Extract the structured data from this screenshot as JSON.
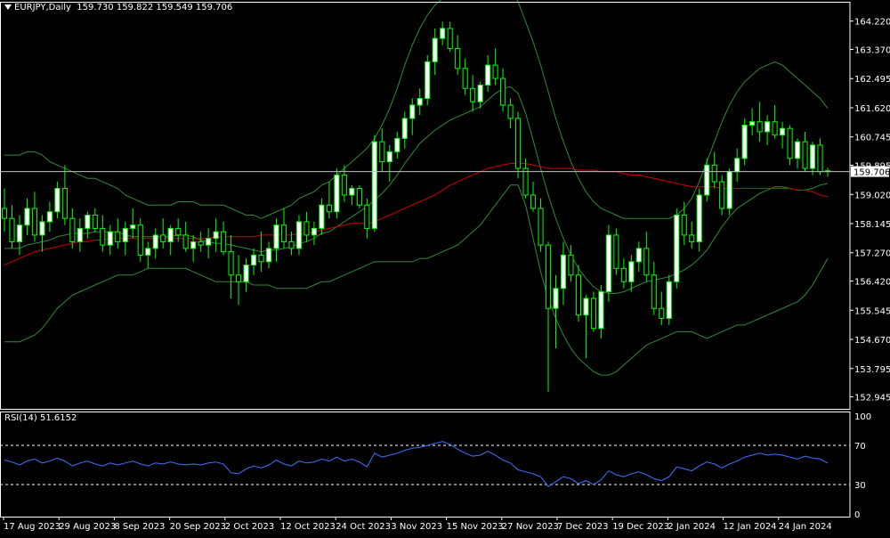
{
  "header": {
    "symbol_label": "EURJPY,Daily",
    "ohlc_label": "159.730 159.822 159.549 159.706"
  },
  "rsi": {
    "label": "RSI(14) 51.6152",
    "levels": [
      70,
      30
    ],
    "range": [
      0,
      100
    ],
    "tick_labels": [
      "100",
      "70",
      "30",
      "0"
    ]
  },
  "colors": {
    "background": "#000000",
    "frame": "#ffffff",
    "bull_body": "#ffffff",
    "bear_body": "#000000",
    "candle_outline": "#00ff00",
    "bollinger": "#2e8b3a",
    "ma": "#d40000",
    "rsi_line": "#3b74ff",
    "current_price_line": "#c0c0c0",
    "current_price_box_bg": "#ffffff",
    "current_price_box_text": "#000000"
  },
  "price_axis": {
    "ticks": [
      "164.220",
      "163.370",
      "162.495",
      "161.620",
      "160.745",
      "159.895",
      "159.020",
      "158.145",
      "157.270",
      "156.420",
      "155.545",
      "154.670",
      "153.795",
      "152.945"
    ],
    "current_price": "159.706"
  },
  "time_axis": {
    "labels": [
      "17 Aug 2023",
      "29 Aug 2023",
      "8 Sep 2023",
      "20 Sep 2023",
      "2 Oct 2023",
      "12 Oct 2023",
      "24 Oct 2023",
      "3 Nov 2023",
      "15 Nov 2023",
      "27 Nov 2023",
      "7 Dec 2023",
      "19 Dec 2023",
      "2 Jan 2024",
      "12 Jan 2024",
      "24 Jan 2024"
    ]
  },
  "chart_data": {
    "type": "candlestick",
    "symbol": "EURJPY",
    "timeframe": "Daily",
    "ylim": [
      152.8,
      164.8
    ],
    "candles": [
      [
        158.6,
        159.2,
        157.9,
        158.3
      ],
      [
        158.3,
        158.7,
        157.4,
        157.6
      ],
      [
        157.6,
        158.4,
        157.2,
        158.1
      ],
      [
        158.1,
        158.9,
        157.8,
        158.6
      ],
      [
        158.6,
        159.1,
        157.6,
        157.8
      ],
      [
        157.8,
        158.4,
        157.3,
        158.2
      ],
      [
        158.2,
        158.8,
        157.9,
        158.5
      ],
      [
        158.5,
        159.4,
        158.3,
        159.2
      ],
      [
        159.2,
        159.9,
        158.1,
        158.3
      ],
      [
        158.3,
        158.6,
        157.4,
        157.6
      ],
      [
        157.6,
        158.3,
        157.3,
        158.0
      ],
      [
        158.0,
        158.5,
        157.7,
        158.4
      ],
      [
        158.4,
        158.6,
        157.9,
        158.0
      ],
      [
        158.0,
        158.4,
        157.3,
        157.5
      ],
      [
        157.5,
        158.1,
        157.2,
        157.9
      ],
      [
        157.9,
        158.3,
        157.4,
        157.6
      ],
      [
        157.6,
        158.2,
        157.2,
        158.0
      ],
      [
        158.0,
        158.6,
        157.7,
        158.1
      ],
      [
        158.1,
        158.3,
        157.0,
        157.2
      ],
      [
        157.2,
        157.6,
        156.8,
        157.4
      ],
      [
        157.4,
        158.0,
        157.1,
        157.8
      ],
      [
        157.8,
        158.3,
        157.4,
        157.6
      ],
      [
        157.6,
        158.1,
        157.2,
        158.0
      ],
      [
        158.0,
        158.3,
        157.6,
        157.8
      ],
      [
        157.8,
        158.2,
        157.3,
        157.4
      ],
      [
        157.4,
        157.8,
        157.0,
        157.6
      ],
      [
        157.6,
        157.9,
        157.3,
        157.5
      ],
      [
        157.5,
        158.0,
        157.1,
        157.7
      ],
      [
        157.7,
        158.3,
        157.3,
        157.9
      ],
      [
        157.9,
        158.2,
        157.2,
        157.3
      ],
      [
        157.3,
        157.8,
        155.9,
        156.6
      ],
      [
        156.6,
        157.2,
        155.7,
        156.4
      ],
      [
        156.4,
        157.1,
        156.1,
        156.9
      ],
      [
        156.9,
        157.4,
        156.6,
        157.2
      ],
      [
        157.2,
        157.9,
        156.7,
        157.0
      ],
      [
        157.0,
        157.6,
        156.8,
        157.4
      ],
      [
        157.4,
        158.3,
        157.0,
        158.1
      ],
      [
        158.1,
        158.6,
        157.4,
        157.6
      ],
      [
        157.6,
        157.9,
        157.2,
        157.4
      ],
      [
        157.4,
        158.4,
        157.2,
        158.2
      ],
      [
        158.2,
        158.5,
        157.6,
        157.8
      ],
      [
        157.8,
        158.2,
        157.5,
        158.0
      ],
      [
        158.0,
        158.9,
        157.8,
        158.7
      ],
      [
        158.7,
        159.4,
        158.3,
        158.5
      ],
      [
        158.5,
        159.8,
        158.3,
        159.6
      ],
      [
        159.6,
        159.9,
        158.8,
        159.0
      ],
      [
        159.0,
        159.3,
        158.7,
        159.2
      ],
      [
        159.2,
        159.3,
        158.6,
        158.7
      ],
      [
        158.7,
        158.9,
        157.7,
        158.0
      ],
      [
        158.0,
        160.8,
        157.9,
        160.6
      ],
      [
        160.6,
        161.0,
        159.7,
        160.0
      ],
      [
        160.0,
        160.5,
        159.4,
        160.3
      ],
      [
        160.3,
        160.9,
        160.1,
        160.7
      ],
      [
        160.7,
        161.5,
        160.4,
        161.3
      ],
      [
        161.3,
        161.9,
        160.8,
        161.7
      ],
      [
        161.7,
        162.2,
        161.4,
        161.9
      ],
      [
        161.9,
        163.2,
        161.7,
        163.0
      ],
      [
        163.0,
        164.0,
        162.6,
        163.7
      ],
      [
        163.7,
        164.2,
        163.5,
        164.0
      ],
      [
        164.0,
        164.2,
        163.3,
        163.4
      ],
      [
        163.4,
        163.8,
        162.6,
        162.8
      ],
      [
        162.8,
        163.1,
        162.0,
        162.2
      ],
      [
        162.2,
        162.6,
        161.5,
        161.8
      ],
      [
        161.8,
        162.4,
        161.6,
        162.3
      ],
      [
        162.3,
        163.2,
        162.1,
        162.9
      ],
      [
        162.9,
        163.4,
        162.3,
        162.5
      ],
      [
        162.5,
        162.8,
        161.5,
        161.7
      ],
      [
        161.7,
        161.9,
        161.0,
        161.3
      ],
      [
        161.3,
        161.5,
        159.5,
        159.8
      ],
      [
        159.8,
        160.1,
        158.9,
        159.0
      ],
      [
        159.0,
        159.4,
        158.5,
        158.6
      ],
      [
        158.6,
        158.9,
        157.3,
        157.5
      ],
      [
        157.5,
        157.6,
        153.1,
        155.6
      ],
      [
        155.6,
        156.6,
        154.4,
        156.2
      ],
      [
        156.2,
        157.6,
        155.7,
        157.2
      ],
      [
        157.2,
        157.5,
        156.4,
        156.6
      ],
      [
        156.6,
        156.9,
        155.2,
        155.4
      ],
      [
        155.4,
        156.0,
        154.1,
        155.9
      ],
      [
        155.9,
        156.1,
        154.9,
        155.0
      ],
      [
        155.0,
        156.3,
        154.7,
        156.1
      ],
      [
        156.1,
        158.1,
        155.8,
        157.8
      ],
      [
        157.8,
        158.0,
        156.6,
        156.8
      ],
      [
        156.8,
        157.1,
        156.2,
        156.4
      ],
      [
        156.4,
        157.2,
        156.1,
        157.0
      ],
      [
        157.0,
        157.6,
        156.7,
        157.4
      ],
      [
        157.4,
        157.9,
        156.4,
        156.6
      ],
      [
        156.6,
        157.0,
        155.4,
        155.6
      ],
      [
        155.6,
        156.1,
        155.1,
        155.3
      ],
      [
        155.3,
        156.6,
        155.1,
        156.4
      ],
      [
        156.4,
        158.6,
        156.2,
        158.4
      ],
      [
        158.4,
        158.8,
        157.5,
        157.8
      ],
      [
        157.8,
        158.2,
        157.4,
        157.6
      ],
      [
        157.6,
        159.2,
        157.3,
        159.0
      ],
      [
        159.0,
        160.1,
        158.8,
        159.9
      ],
      [
        159.9,
        160.3,
        159.2,
        159.4
      ],
      [
        159.4,
        159.6,
        158.4,
        158.6
      ],
      [
        158.6,
        159.8,
        158.4,
        159.7
      ],
      [
        159.7,
        160.4,
        159.4,
        160.1
      ],
      [
        160.1,
        161.3,
        159.9,
        161.1
      ],
      [
        161.1,
        161.6,
        160.8,
        161.2
      ],
      [
        161.2,
        161.8,
        160.6,
        160.9
      ],
      [
        160.9,
        161.4,
        160.5,
        161.2
      ],
      [
        161.2,
        161.7,
        160.7,
        160.8
      ],
      [
        160.8,
        161.2,
        160.4,
        161.0
      ],
      [
        161.0,
        161.1,
        159.9,
        160.1
      ],
      [
        160.1,
        160.7,
        159.8,
        160.6
      ],
      [
        160.6,
        160.9,
        159.7,
        159.8
      ],
      [
        159.8,
        160.6,
        159.6,
        160.5
      ],
      [
        160.5,
        160.7,
        159.6,
        159.7
      ],
      [
        159.73,
        159.82,
        159.55,
        159.71
      ]
    ],
    "moving_average": [
      156.9,
      157.0,
      157.1,
      157.2,
      157.3,
      157.35,
      157.4,
      157.45,
      157.5,
      157.55,
      157.6,
      157.6,
      157.65,
      157.65,
      157.7,
      157.7,
      157.7,
      157.7,
      157.7,
      157.7,
      157.7,
      157.7,
      157.7,
      157.7,
      157.7,
      157.7,
      157.7,
      157.7,
      157.75,
      157.75,
      157.75,
      157.75,
      157.75,
      157.75,
      157.8,
      157.8,
      157.8,
      157.8,
      157.8,
      157.85,
      157.85,
      157.9,
      157.95,
      158.0,
      158.05,
      158.1,
      158.15,
      158.15,
      158.15,
      158.2,
      158.3,
      158.4,
      158.5,
      158.6,
      158.7,
      158.8,
      158.9,
      159.0,
      159.15,
      159.3,
      159.4,
      159.5,
      159.6,
      159.7,
      159.8,
      159.85,
      159.9,
      159.95,
      159.95,
      159.95,
      159.9,
      159.85,
      159.8,
      159.8,
      159.8,
      159.8,
      159.75,
      159.75,
      159.75,
      159.7,
      159.7,
      159.7,
      159.65,
      159.6,
      159.6,
      159.55,
      159.5,
      159.45,
      159.4,
      159.35,
      159.3,
      159.25,
      159.25,
      159.25,
      159.25,
      159.2,
      159.2,
      159.2,
      159.2,
      159.2,
      159.2,
      159.2,
      159.2,
      159.2,
      159.2,
      159.15,
      159.15,
      159.1,
      159.0,
      158.95
    ]
  },
  "bollinger_data": {
    "upper": [
      160.2,
      160.2,
      160.2,
      160.3,
      160.3,
      160.2,
      160.0,
      159.9,
      159.8,
      159.7,
      159.6,
      159.5,
      159.5,
      159.4,
      159.3,
      159.2,
      159.0,
      158.9,
      158.8,
      158.7,
      158.7,
      158.7,
      158.7,
      158.8,
      158.8,
      158.8,
      158.7,
      158.7,
      158.7,
      158.7,
      158.6,
      158.5,
      158.4,
      158.4,
      158.3,
      158.4,
      158.5,
      158.6,
      158.7,
      158.9,
      159.0,
      159.1,
      159.3,
      159.4,
      159.6,
      159.8,
      160.0,
      160.2,
      160.4,
      160.7,
      161.1,
      161.6,
      162.2,
      162.9,
      163.5,
      164.0,
      164.4,
      164.7,
      164.9,
      165.1,
      165.2,
      165.2,
      165.2,
      165.2,
      165.3,
      165.4,
      165.4,
      165.2,
      164.8,
      164.2,
      163.6,
      162.9,
      162.1,
      161.3,
      160.6,
      160.0,
      159.5,
      159.1,
      158.8,
      158.6,
      158.5,
      158.4,
      158.3,
      158.3,
      158.3,
      158.3,
      158.3,
      158.3,
      158.3,
      158.4,
      158.6,
      158.9,
      159.4,
      160.0,
      160.6,
      161.2,
      161.7,
      162.1,
      162.4,
      162.6,
      162.8,
      162.9,
      163.0,
      162.9,
      162.7,
      162.5,
      162.3,
      162.1,
      161.9,
      161.6
    ],
    "lower": [
      154.6,
      154.6,
      154.6,
      154.7,
      154.8,
      155.0,
      155.3,
      155.6,
      155.8,
      156.0,
      156.1,
      156.2,
      156.3,
      156.4,
      156.5,
      156.6,
      156.6,
      156.6,
      156.7,
      156.8,
      156.8,
      156.8,
      156.8,
      156.8,
      156.8,
      156.7,
      156.6,
      156.5,
      156.4,
      156.4,
      156.4,
      156.4,
      156.4,
      156.3,
      156.3,
      156.3,
      156.2,
      156.2,
      156.2,
      156.2,
      156.2,
      156.3,
      156.4,
      156.4,
      156.5,
      156.6,
      156.7,
      156.8,
      156.9,
      157.0,
      157.0,
      157.0,
      157.0,
      157.0,
      157.0,
      157.1,
      157.1,
      157.2,
      157.3,
      157.4,
      157.5,
      157.7,
      157.9,
      158.1,
      158.4,
      158.7,
      159.0,
      159.3,
      159.3,
      158.7,
      157.7,
      156.7,
      155.9,
      155.3,
      154.8,
      154.4,
      154.1,
      153.9,
      153.7,
      153.6,
      153.6,
      153.7,
      153.9,
      154.1,
      154.3,
      154.5,
      154.6,
      154.7,
      154.8,
      154.9,
      154.9,
      154.9,
      154.8,
      154.7,
      154.8,
      154.9,
      155.0,
      155.1,
      155.1,
      155.2,
      155.3,
      155.4,
      155.5,
      155.6,
      155.7,
      155.8,
      156.0,
      156.3,
      156.7,
      157.1
    ],
    "middle": [
      157.4,
      157.4,
      157.4,
      157.5,
      157.55,
      157.6,
      157.65,
      157.75,
      157.8,
      157.85,
      157.85,
      157.85,
      157.9,
      157.9,
      157.9,
      157.9,
      157.8,
      157.75,
      157.75,
      157.75,
      157.75,
      157.75,
      157.75,
      157.8,
      157.8,
      157.75,
      157.65,
      157.6,
      157.55,
      157.55,
      157.5,
      157.45,
      157.4,
      157.35,
      157.3,
      157.35,
      157.35,
      157.4,
      157.45,
      157.55,
      157.6,
      157.7,
      157.85,
      157.9,
      158.05,
      158.2,
      158.35,
      158.5,
      158.65,
      158.85,
      159.05,
      159.3,
      159.6,
      159.95,
      160.25,
      160.55,
      160.75,
      160.95,
      161.1,
      161.25,
      161.35,
      161.45,
      161.55,
      161.65,
      161.85,
      162.05,
      162.2,
      162.25,
      162.05,
      161.45,
      160.65,
      159.8,
      159.0,
      158.3,
      157.7,
      157.2,
      156.8,
      156.5,
      156.25,
      156.1,
      156.05,
      156.05,
      156.1,
      156.2,
      156.3,
      156.4,
      156.45,
      156.5,
      156.55,
      156.65,
      156.75,
      156.9,
      157.1,
      157.35,
      157.7,
      158.05,
      158.35,
      158.6,
      158.75,
      158.9,
      159.05,
      159.15,
      159.25,
      159.25,
      159.2,
      159.15,
      159.15,
      159.2,
      159.3,
      159.35
    ],
    "rsi_values": [
      55,
      53,
      50,
      54,
      56,
      52,
      54,
      57,
      54,
      49,
      52,
      54,
      51,
      49,
      52,
      50,
      52,
      54,
      51,
      49,
      52,
      51,
      53,
      51,
      50,
      51,
      50,
      52,
      53,
      51,
      42,
      41,
      46,
      49,
      47,
      50,
      55,
      51,
      49,
      54,
      52,
      53,
      56,
      54,
      58,
      54,
      56,
      53,
      48,
      62,
      58,
      60,
      62,
      65,
      67,
      68,
      70,
      72,
      74,
      71,
      66,
      62,
      59,
      60,
      64,
      60,
      55,
      52,
      45,
      43,
      41,
      38,
      28,
      33,
      38,
      36,
      31,
      34,
      30,
      35,
      44,
      40,
      38,
      41,
      43,
      40,
      36,
      34,
      38,
      48,
      46,
      44,
      49,
      53,
      51,
      47,
      51,
      54,
      58,
      60,
      62,
      60,
      61,
      60,
      58,
      56,
      59,
      57,
      56,
      52
    ]
  }
}
